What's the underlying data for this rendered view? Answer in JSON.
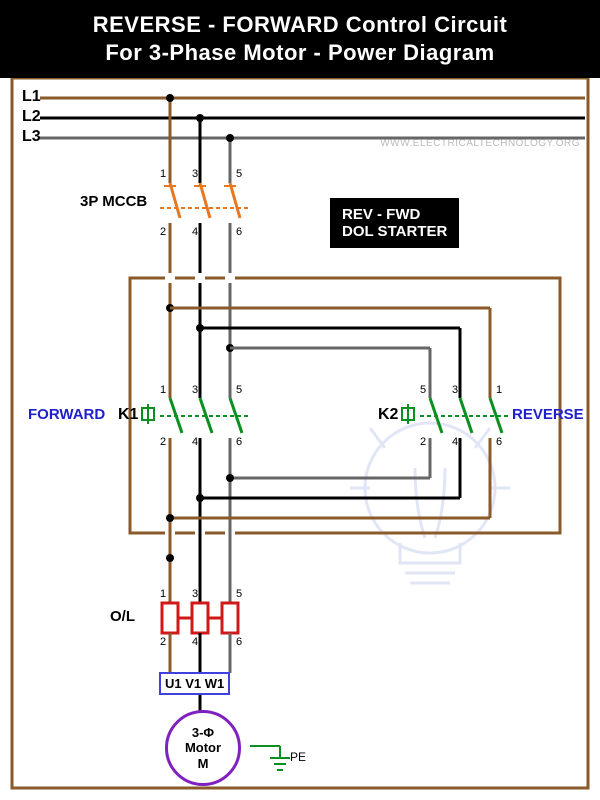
{
  "header": {
    "line1": "REVERSE - FORWARD Control Circuit",
    "line2": "For 3-Phase Motor - Power Diagram"
  },
  "watermark": "WWW.ELECTRICALTECHNOLOGY.ORG",
  "phases": {
    "l1": "L1",
    "l2": "L2",
    "l3": "L3"
  },
  "components": {
    "mccb": "3P MCCB",
    "starter_box_line1": "REV - FWD",
    "starter_box_line2": "DOL STARTER",
    "forward": "FORWARD",
    "reverse": "REVERSE",
    "k1": "K1",
    "k2": "K2",
    "overload": "O/L",
    "terminals": {
      "u1": "U1",
      "v1": "V1",
      "w1": "W1"
    },
    "motor_line1": "3-Φ",
    "motor_line2": "Motor",
    "motor_line3": "M",
    "pe": "PE"
  },
  "terminal_nums": {
    "t1": "1",
    "t2": "2",
    "t3": "3",
    "t4": "4",
    "t5": "5",
    "t6": "6"
  },
  "colors": {
    "l1": "#8a5a2a",
    "l2": "#000",
    "l3": "#666",
    "mccb": "#e87722",
    "contactor": "#0a9020",
    "ol": "#d01818",
    "border": "#8a5a2a",
    "blue": "#2020cc"
  }
}
